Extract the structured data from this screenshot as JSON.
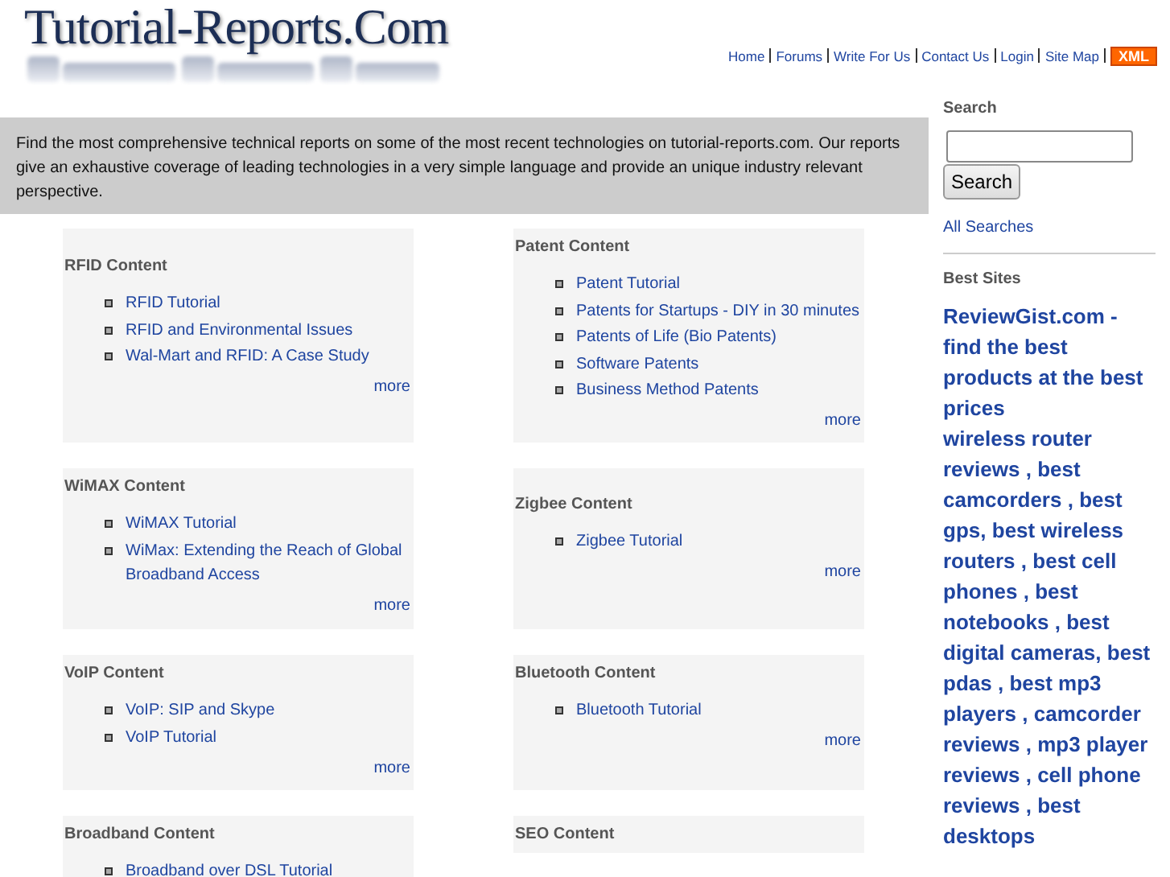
{
  "logo": {
    "text": "Tutorial-Reports.Com"
  },
  "nav": {
    "links": [
      "Home",
      "Forums",
      "Write For Us",
      "Contact Us",
      "Login",
      "Site Map"
    ],
    "feed_badge": "XML"
  },
  "intro": "Find the most comprehensive technical reports on some of the most recent technologies on tutorial-reports.com. Our reports give an exhaustive coverage of leading technologies in a very simple language and provide an unique industry relevant perspective.",
  "columns": [
    [
      {
        "title": "RFID Content",
        "links": [
          "RFID Tutorial",
          "RFID and Environmental Issues",
          "Wal-Mart and RFID: A Case Study"
        ],
        "more": "more"
      },
      {
        "title": "WiMAX Content",
        "links": [
          "WiMAX Tutorial",
          "WiMax: Extending the Reach of Global Broadband Access"
        ],
        "more": "more"
      },
      {
        "title": "VoIP Content",
        "links": [
          "VoIP: SIP and Skype",
          "VoIP Tutorial"
        ],
        "more": "more"
      },
      {
        "title": "Broadband Content",
        "links": [
          "Broadband over DSL Tutorial"
        ]
      }
    ],
    [
      {
        "title": "Patent Content",
        "links": [
          "Patent Tutorial",
          "Patents for Startups - DIY in 30 minutes",
          "Patents of Life (Bio Patents)",
          "Software Patents",
          "Business Method Patents"
        ],
        "more": "more"
      },
      {
        "title": "Zigbee Content",
        "links": [
          "Zigbee Tutorial"
        ],
        "more": "more"
      },
      {
        "title": "Bluetooth Content",
        "links": [
          "Bluetooth Tutorial"
        ],
        "more": "more"
      },
      {
        "title": "SEO Content"
      }
    ]
  ],
  "sidebar": {
    "search_heading": "Search",
    "search_button": "Search",
    "all_searches": "All Searches",
    "best_sites_heading": "Best Sites",
    "featured": "ReviewGist.com - find the best products at the best prices",
    "links": [
      {
        "text": "wireless router reviews",
        "sep": " ,"
      },
      {
        "text": "best camcorders",
        "sep": " ,"
      },
      {
        "text": "best gps",
        "sep": ","
      },
      {
        "text": "best wireless routers",
        "sep": " ,"
      },
      {
        "text": "best cell phones",
        "sep": " ,"
      },
      {
        "text": "best notebooks",
        "sep": " ,"
      },
      {
        "text": "best digital cameras",
        "sep": ","
      },
      {
        "text": "best pdas",
        "sep": " ,"
      },
      {
        "text": "best mp3 players",
        "sep": " ,"
      },
      {
        "text": "camcorder reviews",
        "sep": " ,"
      },
      {
        "text": "mp3 player reviews",
        "sep": " ,"
      },
      {
        "text": "cell phone reviews",
        "sep": " ,"
      },
      {
        "text": "best desktops"
      }
    ]
  }
}
